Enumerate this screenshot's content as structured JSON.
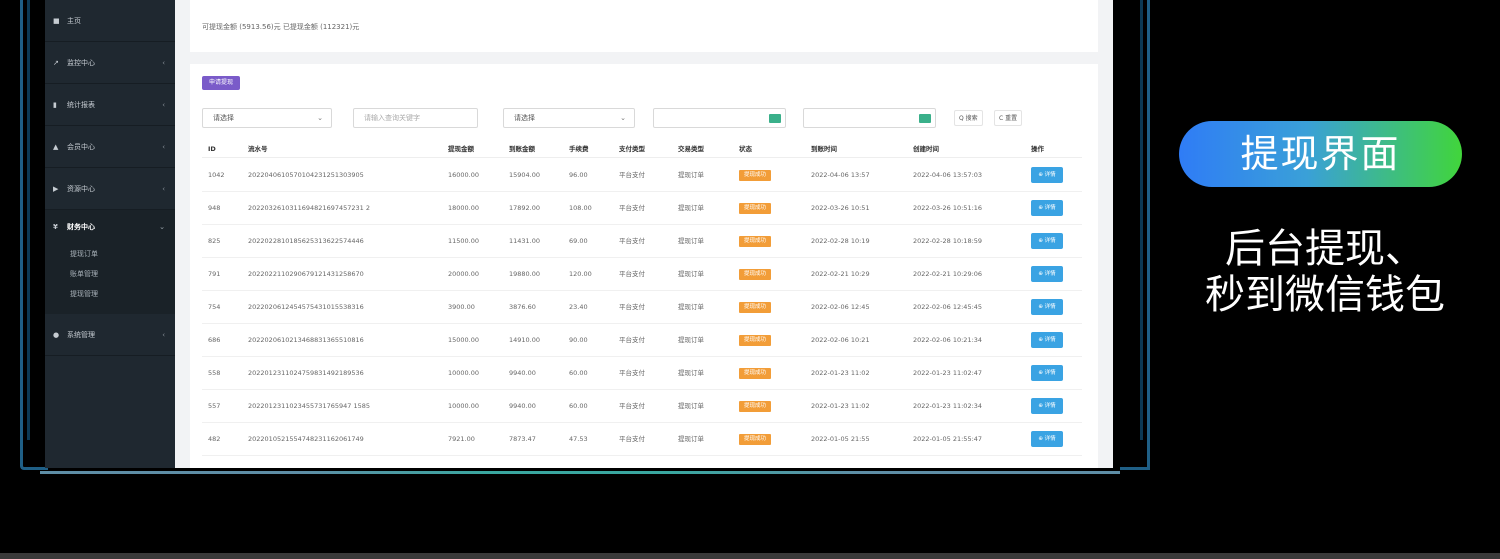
{
  "sidebar": {
    "items": [
      {
        "label": "主页",
        "icon": "home-icon",
        "glyph": "■"
      },
      {
        "label": "监控中心",
        "icon": "wrench-icon",
        "glyph": "↗"
      },
      {
        "label": "统计报表",
        "icon": "chart-icon",
        "glyph": "▮"
      },
      {
        "label": "会员中心",
        "icon": "user-icon",
        "glyph": "▲"
      },
      {
        "label": "资源中心",
        "icon": "video-icon",
        "glyph": "▶"
      }
    ],
    "active": {
      "label": "财务中心",
      "icon": "yen-icon",
      "glyph": "¥"
    },
    "sub_items": [
      "提现订单",
      "账单管理",
      "提现管理"
    ],
    "bottom": {
      "label": "系统管理",
      "icon": "gear-icon",
      "glyph": "●"
    },
    "arrow": "‹",
    "active_arrow": "⌄"
  },
  "info": {
    "text": "可提现金额 (5913.56)元 已提现金额 (112321)元"
  },
  "toolbar": {
    "apply_label": "申请提现",
    "select1": "请选择",
    "keyword_placeholder": "请输入查询关键字",
    "select2": "请选择",
    "date_start": "",
    "date_end": "",
    "search_label": "Q 搜索",
    "reset_label": "C 重置"
  },
  "table": {
    "headers": [
      "ID",
      "流水号",
      "提现金额",
      "到账金额",
      "手续费",
      "支付类型",
      "交易类型",
      "状态",
      "到账时间",
      "创建时间",
      "操作"
    ],
    "rows": [
      {
        "id": "1042",
        "serial": "2022040610570104231251303905",
        "amount": "16000.00",
        "received": "15904.00",
        "fee": "96.00",
        "pay_type": "平台支付",
        "trade_type": "提现订单",
        "status": "提现成功",
        "arrive_time": "2022-04-06 13:57",
        "create_time": "2022-04-06 13:57:03",
        "action": "⊕ 详情"
      },
      {
        "id": "948",
        "serial": "2022032610311694821697457231 2",
        "amount": "18000.00",
        "received": "17892.00",
        "fee": "108.00",
        "pay_type": "平台支付",
        "trade_type": "提现订单",
        "status": "提现成功",
        "arrive_time": "2022-03-26 10:51",
        "create_time": "2022-03-26 10:51:16",
        "action": "⊕ 详情"
      },
      {
        "id": "825",
        "serial": "2022022810185625313622574446",
        "amount": "11500.00",
        "received": "11431.00",
        "fee": "69.00",
        "pay_type": "平台支付",
        "trade_type": "提现订单",
        "status": "提现成功",
        "arrive_time": "2022-02-28 10:19",
        "create_time": "2022-02-28 10:18:59",
        "action": "⊕ 详情"
      },
      {
        "id": "791",
        "serial": "2022022110290679121431258670",
        "amount": "20000.00",
        "received": "19880.00",
        "fee": "120.00",
        "pay_type": "平台支付",
        "trade_type": "提现订单",
        "status": "提现成功",
        "arrive_time": "2022-02-21 10:29",
        "create_time": "2022-02-21 10:29:06",
        "action": "⊕ 详情"
      },
      {
        "id": "754",
        "serial": "2022020612454575431015538316",
        "amount": "3900.00",
        "received": "3876.60",
        "fee": "23.40",
        "pay_type": "平台支付",
        "trade_type": "提现订单",
        "status": "提现成功",
        "arrive_time": "2022-02-06 12:45",
        "create_time": "2022-02-06 12:45:45",
        "action": "⊕ 详情"
      },
      {
        "id": "686",
        "serial": "2022020610213468831365510816",
        "amount": "15000.00",
        "received": "14910.00",
        "fee": "90.00",
        "pay_type": "平台支付",
        "trade_type": "提现订单",
        "status": "提现成功",
        "arrive_time": "2022-02-06 10:21",
        "create_time": "2022-02-06 10:21:34",
        "action": "⊕ 详情"
      },
      {
        "id": "558",
        "serial": "2022012311024759831492189536",
        "amount": "10000.00",
        "received": "9940.00",
        "fee": "60.00",
        "pay_type": "平台支付",
        "trade_type": "提现订单",
        "status": "提现成功",
        "arrive_time": "2022-01-23 11:02",
        "create_time": "2022-01-23 11:02:47",
        "action": "⊕ 详情"
      },
      {
        "id": "557",
        "serial": "2022012311023455731765947 1585",
        "amount": "10000.00",
        "received": "9940.00",
        "fee": "60.00",
        "pay_type": "平台支付",
        "trade_type": "提现订单",
        "status": "提现成功",
        "arrive_time": "2022-01-23 11:02",
        "create_time": "2022-01-23 11:02:34",
        "action": "⊕ 详情"
      },
      {
        "id": "482",
        "serial": "2022010521554748231162061749",
        "amount": "7921.00",
        "received": "7873.47",
        "fee": "47.53",
        "pay_type": "平台支付",
        "trade_type": "提现订单",
        "status": "提现成功",
        "arrive_time": "2022-01-05 21:55",
        "create_time": "2022-01-05 21:55:47",
        "action": "⊕ 详情"
      }
    ]
  },
  "promo": {
    "pill": "提现界面",
    "line1": "后台提现、",
    "line2": "秒到微信钱包"
  },
  "colors": {
    "status_badge": "#f29d38",
    "detail_button": "#3aa3e3",
    "apply_button": "#7a5bc9",
    "sidebar_bg": "#1f2830"
  }
}
